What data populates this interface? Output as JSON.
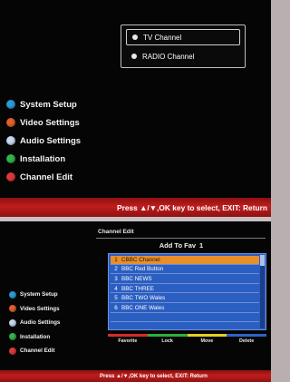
{
  "top_screen": {
    "channel_popup": {
      "options": [
        {
          "label": "TV Channel",
          "selected": true
        },
        {
          "label": "RADIO Channel",
          "selected": false
        }
      ]
    },
    "side_menu": [
      {
        "label": "System Setup",
        "color": "#2a9bd8"
      },
      {
        "label": "Video Settings",
        "color": "#e0602a"
      },
      {
        "label": "Audio Settings",
        "color": "#c9d8f0"
      },
      {
        "label": "Installation",
        "color": "#35b24a"
      },
      {
        "label": "Channel Edit",
        "color": "#e03838"
      }
    ],
    "help_text": "Press ▲/▼,OK key to select, EXIT: Return"
  },
  "bottom_screen": {
    "panel_title": "Channel Edit",
    "fav_heading": {
      "label": "Add To Fav",
      "number": "1"
    },
    "channels": [
      {
        "num": "1",
        "name": "CBBC Channel",
        "selected": true
      },
      {
        "num": "2",
        "name": "BBC Red Button",
        "selected": false
      },
      {
        "num": "3",
        "name": "BBC NEWS",
        "selected": false
      },
      {
        "num": "4",
        "name": "BBC THREE",
        "selected": false
      },
      {
        "num": "5",
        "name": "BBC TWO Wales",
        "selected": false
      },
      {
        "num": "6",
        "name": "BBC ONE Wales",
        "selected": false
      }
    ],
    "color_keys": [
      {
        "label": "Favorite",
        "color": "#d62b2b"
      },
      {
        "label": "Lock",
        "color": "#2fae3f"
      },
      {
        "label": "Move",
        "color": "#e6cf22"
      },
      {
        "label": "Delete",
        "color": "#2e63c9"
      }
    ],
    "side_menu": [
      {
        "label": "System Setup",
        "color": "#2a9bd8"
      },
      {
        "label": "Video Settings",
        "color": "#e0602a"
      },
      {
        "label": "Audio Settings",
        "color": "#c9d8f0"
      },
      {
        "label": "Installation",
        "color": "#35b24a"
      },
      {
        "label": "Channel Edit",
        "color": "#e03838"
      }
    ],
    "help_text": "Press ▲/▼,OK key to select, EXIT: Return"
  }
}
